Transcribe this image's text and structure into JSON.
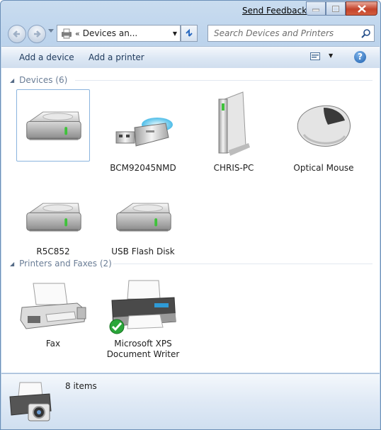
{
  "titlebar": {
    "feedback_label": "Send Feedback",
    "minimize": "minimize",
    "maximize": "maximize",
    "close": "close"
  },
  "navigation": {
    "chevron": "«",
    "address": "Devices an...",
    "search_placeholder": "Search Devices and Printers"
  },
  "commands": {
    "add_device": "Add a device",
    "add_printer": "Add a printer",
    "help": "?"
  },
  "groups": {
    "devices": {
      "header": "Devices (6)",
      "items": [
        {
          "label": "",
          "icon": "hard-drive-icon",
          "selected": true
        },
        {
          "label": "BCM92045NMD",
          "icon": "usb-dongle-icon"
        },
        {
          "label": "CHRIS-PC",
          "icon": "pc-tower-icon"
        },
        {
          "label": "Optical Mouse",
          "icon": "mouse-icon"
        },
        {
          "label": "R5C852",
          "icon": "hard-drive-icon"
        },
        {
          "label": "USB Flash Disk",
          "icon": "hard-drive-icon"
        }
      ]
    },
    "printers": {
      "header": "Printers and Faxes (2)",
      "items": [
        {
          "label": "Fax",
          "icon": "fax-icon"
        },
        {
          "label": "Microsoft XPS Document Writer",
          "icon": "printer-icon",
          "badge": "default-checkmark-icon"
        }
      ]
    }
  },
  "details": {
    "count": "8 items",
    "icon": "printer-camera-icon"
  },
  "colors": {
    "window_frame": "#bcd3ec",
    "command_text": "#1e395b",
    "group_header": "#6a7d96",
    "selection_border": "#8ab4de"
  }
}
